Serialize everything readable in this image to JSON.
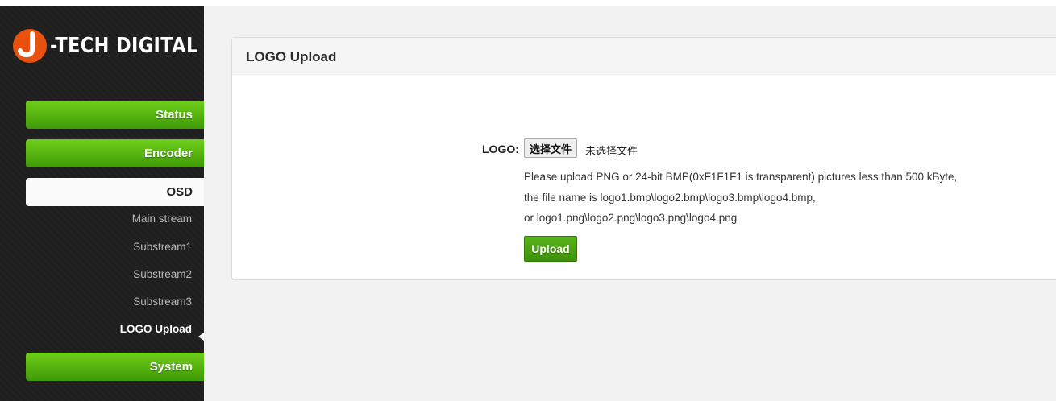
{
  "brand": {
    "logo_text": "-TECH DIGITAL",
    "accent_color": "#e8520e"
  },
  "sidebar": {
    "items": [
      {
        "label": "Status"
      },
      {
        "label": "Encoder"
      },
      {
        "label": "OSD"
      },
      {
        "label": "System"
      }
    ],
    "osd_subitems": [
      {
        "label": "Main stream"
      },
      {
        "label": "Substream1"
      },
      {
        "label": "Substream2"
      },
      {
        "label": "Substream3"
      },
      {
        "label": "LOGO Upload"
      }
    ],
    "selected_subitem": "LOGO Upload"
  },
  "panel": {
    "title": "LOGO Upload",
    "field_label": "LOGO:",
    "file_button_label": "选择文件",
    "file_status": "未选择文件",
    "help_lines": [
      "Please upload PNG or 24-bit BMP(0xF1F1F1 is transparent) pictures less than 500 kByte,",
      "the file name is logo1.bmp\\logo2.bmp\\logo3.bmp\\logo4.bmp,",
      "or logo1.png\\logo2.png\\logo3.png\\logo4.png"
    ],
    "upload_button_label": "Upload"
  },
  "colors": {
    "button_green": "#4caf10",
    "sidebar_bg": "#1f1f1f"
  }
}
